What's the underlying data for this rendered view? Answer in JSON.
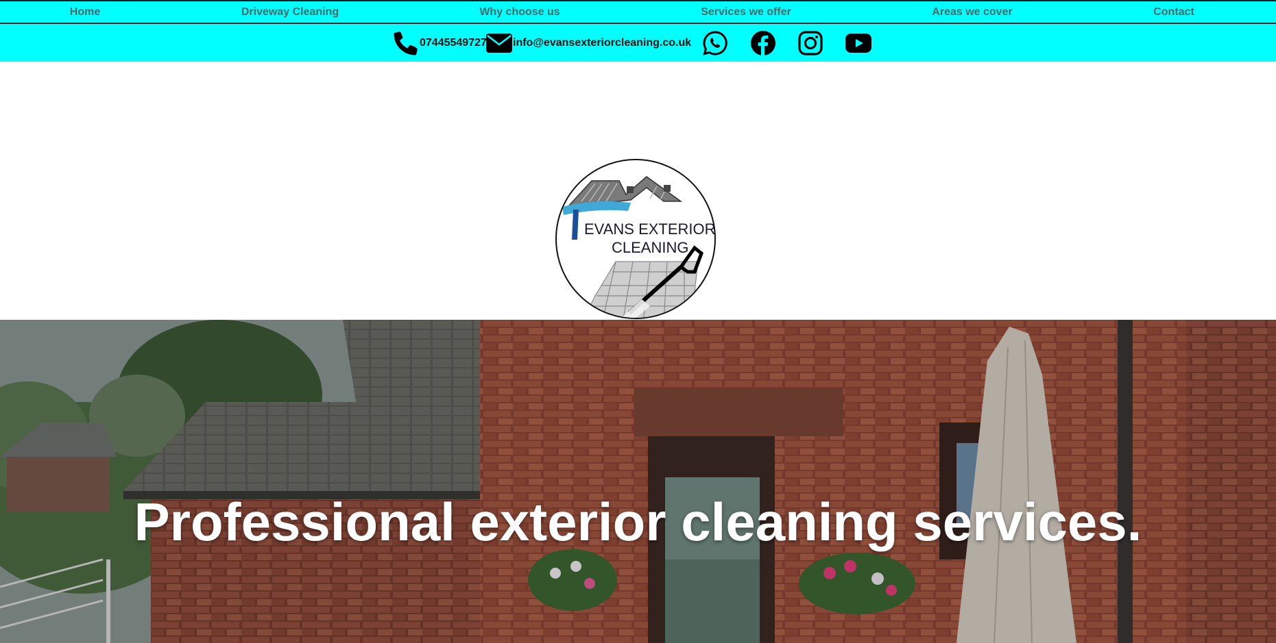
{
  "nav": {
    "items": [
      "Home",
      "Driveway Cleaning",
      "Why choose us",
      "Services we offer",
      "Areas we cover",
      "Contact"
    ]
  },
  "contact": {
    "phone": "07445549727",
    "email": "info@evansexteriorcleaning.co.uk",
    "social_icons": [
      "whatsapp-icon",
      "facebook-icon",
      "instagram-icon",
      "youtube-icon"
    ]
  },
  "logo": {
    "line1": "EVANS EXTERIOR",
    "line2": "CLEANING"
  },
  "hero": {
    "headline": "Professional exterior cleaning services."
  },
  "colors": {
    "nav_bg": "#00ffff",
    "nav_text": "#4a6a6a",
    "brick": "#9a4a36"
  }
}
